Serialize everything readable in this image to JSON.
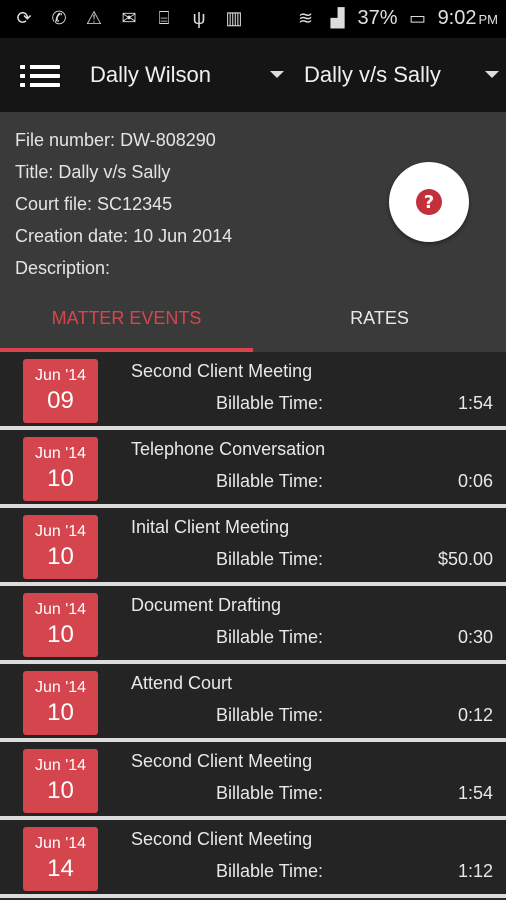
{
  "status": {
    "battery": "37%",
    "time": "9:02",
    "ampm": "PM",
    "icons": [
      "sync-icon",
      "whatsapp-icon",
      "wifi-hotspot-icon",
      "mail-icon",
      "code-icon",
      "usb-icon",
      "barcode-icon"
    ]
  },
  "appbar": {
    "client": "Dally Wilson",
    "matter": "Dally v/s Sally"
  },
  "details": {
    "file_number_label": "File number:",
    "file_number": "DW-808290",
    "title_label": "Title:",
    "title": "Dally v/s Sally",
    "court_file_label": "Court file:",
    "court_file": "SC12345",
    "creation_date_label": "Creation date:",
    "creation_date": "10 Jun 2014",
    "description_label": "Description:",
    "help_glyph": "?"
  },
  "tabs": {
    "events": "MATTER EVENTS",
    "rates": "RATES"
  },
  "events": [
    {
      "month": "Jun '14",
      "day": "09",
      "name": "Second Client Meeting",
      "label": "Billable Time:",
      "value": "1:54"
    },
    {
      "month": "Jun '14",
      "day": "10",
      "name": "Telephone Conversation",
      "label": "Billable Time:",
      "value": "0:06"
    },
    {
      "month": "Jun '14",
      "day": "10",
      "name": "Inital Client Meeting",
      "label": "Billable Time:",
      "value": "$50.00"
    },
    {
      "month": "Jun '14",
      "day": "10",
      "name": "Document Drafting",
      "label": "Billable Time:",
      "value": "0:30"
    },
    {
      "month": "Jun '14",
      "day": "10",
      "name": "Attend Court",
      "label": "Billable Time:",
      "value": "0:12"
    },
    {
      "month": "Jun '14",
      "day": "10",
      "name": "Second Client Meeting",
      "label": "Billable Time:",
      "value": "1:54"
    },
    {
      "month": "Jun '14",
      "day": "14",
      "name": "Second Client Meeting",
      "label": "Billable Time:",
      "value": "1:12"
    }
  ],
  "colors": {
    "accent": "#d5454d",
    "appbar": "#151515",
    "details_bg": "#3a3a3a",
    "list_bg": "#242424"
  }
}
